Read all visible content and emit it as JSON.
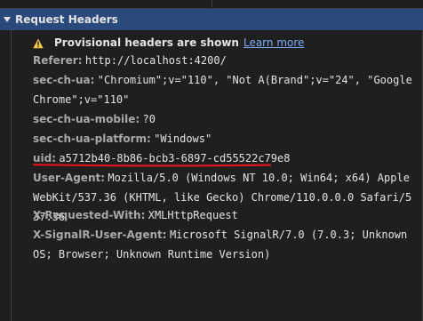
{
  "section": {
    "title": "Request Headers"
  },
  "warning": {
    "text": "Provisional headers are shown",
    "link": "Learn more"
  },
  "headers": [
    {
      "name": "Referer:",
      "value": "http://localhost:4200/"
    },
    {
      "name": "sec-ch-ua:",
      "value": "\"Chromium\";v=\"110\", \"Not A(Brand\";v=\"24\", \"Google Chrome\";v=\"110\""
    },
    {
      "name": "sec-ch-ua-mobile:",
      "value": "?0"
    },
    {
      "name": "sec-ch-ua-platform:",
      "value": "\"Windows\""
    },
    {
      "name": "uid:",
      "value": "a5712b40-8b86-bcb3-6897-cd55522c79e8"
    },
    {
      "name": "User-Agent:",
      "value": "Mozilla/5.0 (Windows NT 10.0; Win64; x64) AppleWebKit/537.36 (KHTML, like Gecko) Chrome/110.0.0.0 Safari/537.36"
    },
    {
      "name": "X-Requested-With:",
      "value": "XMLHttpRequest"
    },
    {
      "name": "X-SignalR-User-Agent:",
      "value": "Microsoft SignalR/7.0 (7.0.3; Unknown OS; Browser; Unknown Runtime Version)"
    }
  ],
  "colors": {
    "header_bg": "#294a7a",
    "warning_icon": "#f2c94c",
    "link": "#7cacf8",
    "annotation": "#e0141e"
  },
  "icons": {
    "warning": "warning-triangle-icon",
    "toggle": "triangle-down-icon"
  }
}
